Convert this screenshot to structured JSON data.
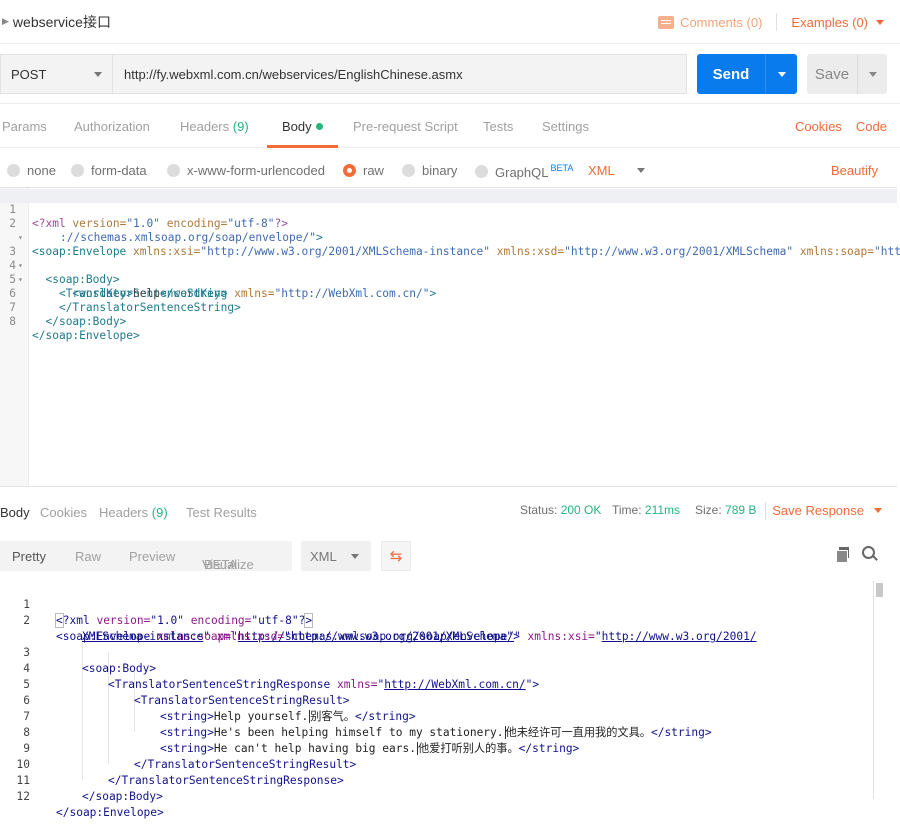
{
  "title_bar": {
    "request_name": "webservice接口",
    "comments_label": "Comments (0)",
    "examples_label": "Examples (0)"
  },
  "request": {
    "method": "POST",
    "url": "http://fy.webxml.com.cn/webservices/EnglishChinese.asmx",
    "send_label": "Send",
    "save_label": "Save"
  },
  "request_tabs": {
    "params": "Params",
    "authorization": "Authorization",
    "headers": "Headers",
    "headers_count": "(9)",
    "body": "Body",
    "pre_request": "Pre-request Script",
    "tests": "Tests",
    "settings": "Settings",
    "cookies": "Cookies",
    "code": "Code"
  },
  "body_types": {
    "none": "none",
    "form_data": "form-data",
    "urlencoded": "x-www-form-urlencoded",
    "raw": "raw",
    "binary": "binary",
    "graphql": "GraphQL",
    "beta": "BETA",
    "format": "XML",
    "beautify": "Beautify",
    "selected": "raw"
  },
  "request_editor": {
    "line_numbers": [
      "1",
      "2",
      "",
      "3",
      "4",
      "5",
      "6",
      "7",
      "8"
    ],
    "fold_markers": [
      "",
      "▾",
      "",
      "▾",
      "▾",
      "",
      "",
      "",
      ""
    ]
  },
  "response_tabs": {
    "body": "Body",
    "cookies": "Cookies",
    "headers": "Headers",
    "headers_count": "(9)",
    "test_results": "Test Results",
    "status_label": "Status:",
    "status_value": "200 OK",
    "time_label": "Time:",
    "time_value": "211ms",
    "size_label": "Size:",
    "size_value": "789 B",
    "save_response": "Save Response"
  },
  "response_toolbar": {
    "pretty": "Pretty",
    "raw": "Raw",
    "preview": "Preview",
    "visualize": "Visualize",
    "beta": "BETA",
    "format": "XML"
  },
  "response_body": {
    "line_numbers": [
      "1",
      "2",
      "",
      "3",
      "4",
      "5",
      "6",
      "7",
      "8",
      "9",
      "10",
      "11",
      "12"
    ]
  },
  "colors": {
    "accent": "#f26b3a",
    "send_blue": "#097bed",
    "success_green": "#26b47f"
  }
}
